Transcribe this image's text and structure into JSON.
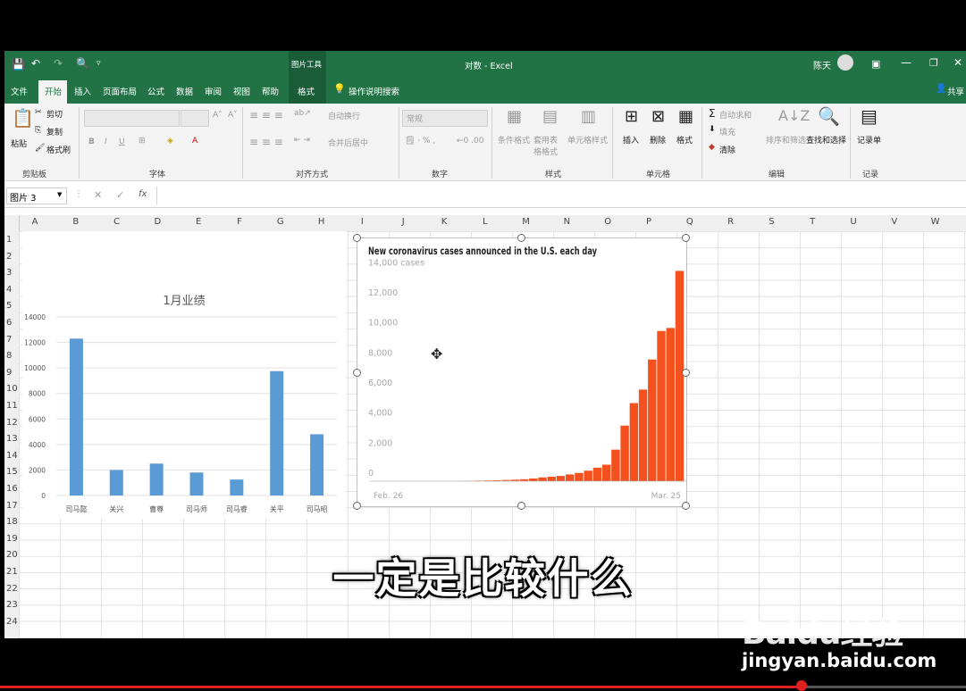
{
  "titlebar": {
    "context_tab": "图片工具",
    "doc_title": "对数 - Excel",
    "user": "陈天"
  },
  "menu": {
    "tabs": [
      "文件",
      "开始",
      "插入",
      "页面布局",
      "公式",
      "数据",
      "审阅",
      "视图",
      "帮助",
      "格式"
    ],
    "search": "操作说明搜索",
    "share": "共享"
  },
  "ribbon": {
    "clipboard": {
      "paste": "粘贴",
      "cut": "剪切",
      "copy": "复制",
      "format_painter": "格式刷",
      "group": "剪贴板"
    },
    "font": {
      "group": "字体",
      "bold": "B",
      "italic": "I",
      "underline": "U"
    },
    "alignment": {
      "wrap": "自动换行",
      "merge": "合并后居中",
      "group": "对齐方式"
    },
    "number": {
      "format": "常规",
      "group": "数字"
    },
    "styles": {
      "conditional": "条件格式",
      "table": "套用表格格式",
      "cell": "单元格样式",
      "group": "样式"
    },
    "cells": {
      "insert": "插入",
      "delete": "删除",
      "format": "格式",
      "group": "单元格"
    },
    "editing": {
      "autosum": "自动求和",
      "fill": "填充",
      "clear": "清除",
      "sort": "排序和筛选",
      "find": "查找和选择",
      "group": "编辑"
    },
    "record": {
      "label": "记录单",
      "group": "记录"
    }
  },
  "formula_bar": {
    "name_box": "图片 3",
    "fx": "fx",
    "value": ""
  },
  "columns": [
    "A",
    "B",
    "C",
    "D",
    "E",
    "F",
    "G",
    "H",
    "I",
    "J",
    "K",
    "L",
    "M",
    "N",
    "O",
    "P",
    "Q",
    "R",
    "S",
    "T",
    "U",
    "V",
    "W"
  ],
  "rows": [
    "1",
    "2",
    "3",
    "4",
    "5",
    "6",
    "7",
    "8",
    "9",
    "10",
    "11",
    "12",
    "13",
    "14",
    "15",
    "16",
    "17",
    "18",
    "19",
    "20",
    "21",
    "22",
    "23",
    "24"
  ],
  "chart_data": [
    {
      "type": "bar",
      "title": "1月业绩",
      "categories": [
        "司马懿",
        "关兴",
        "曹尊",
        "司马师",
        "司马睿",
        "关平",
        "司马昭"
      ],
      "values": [
        12300,
        2000,
        2500,
        1800,
        1250,
        9750,
        4800
      ],
      "ylim": [
        0,
        14000
      ],
      "yticks": [
        "0",
        "2000",
        "4000",
        "6000",
        "8000",
        "10000",
        "12000",
        "14000"
      ],
      "grid": true,
      "color": "#5b9bd5"
    },
    {
      "type": "bar",
      "title": "New coronavirus cases announced in the U.S. each day",
      "x_start": "Feb. 26",
      "x_end": "Mar. 25",
      "values": [
        10,
        20,
        30,
        40,
        50,
        60,
        80,
        100,
        130,
        180,
        250,
        300,
        350,
        450,
        550,
        700,
        900,
        1100,
        2100,
        3700,
        5200,
        6100,
        8100,
        10000,
        10200,
        14000
      ],
      "ylim": [
        0,
        14500
      ],
      "yticks": [
        "0",
        "2,000",
        "4,000",
        "6,000",
        "8,000",
        "10,000",
        "12,000",
        "14,000 cases"
      ],
      "grid": false,
      "color": "#f4511e"
    }
  ],
  "subtitle": "一定是比较什么",
  "watermark": {
    "logo": "Baidu经验",
    "url": "jingyan.baidu.com"
  },
  "video": {
    "progress": 0.83
  }
}
